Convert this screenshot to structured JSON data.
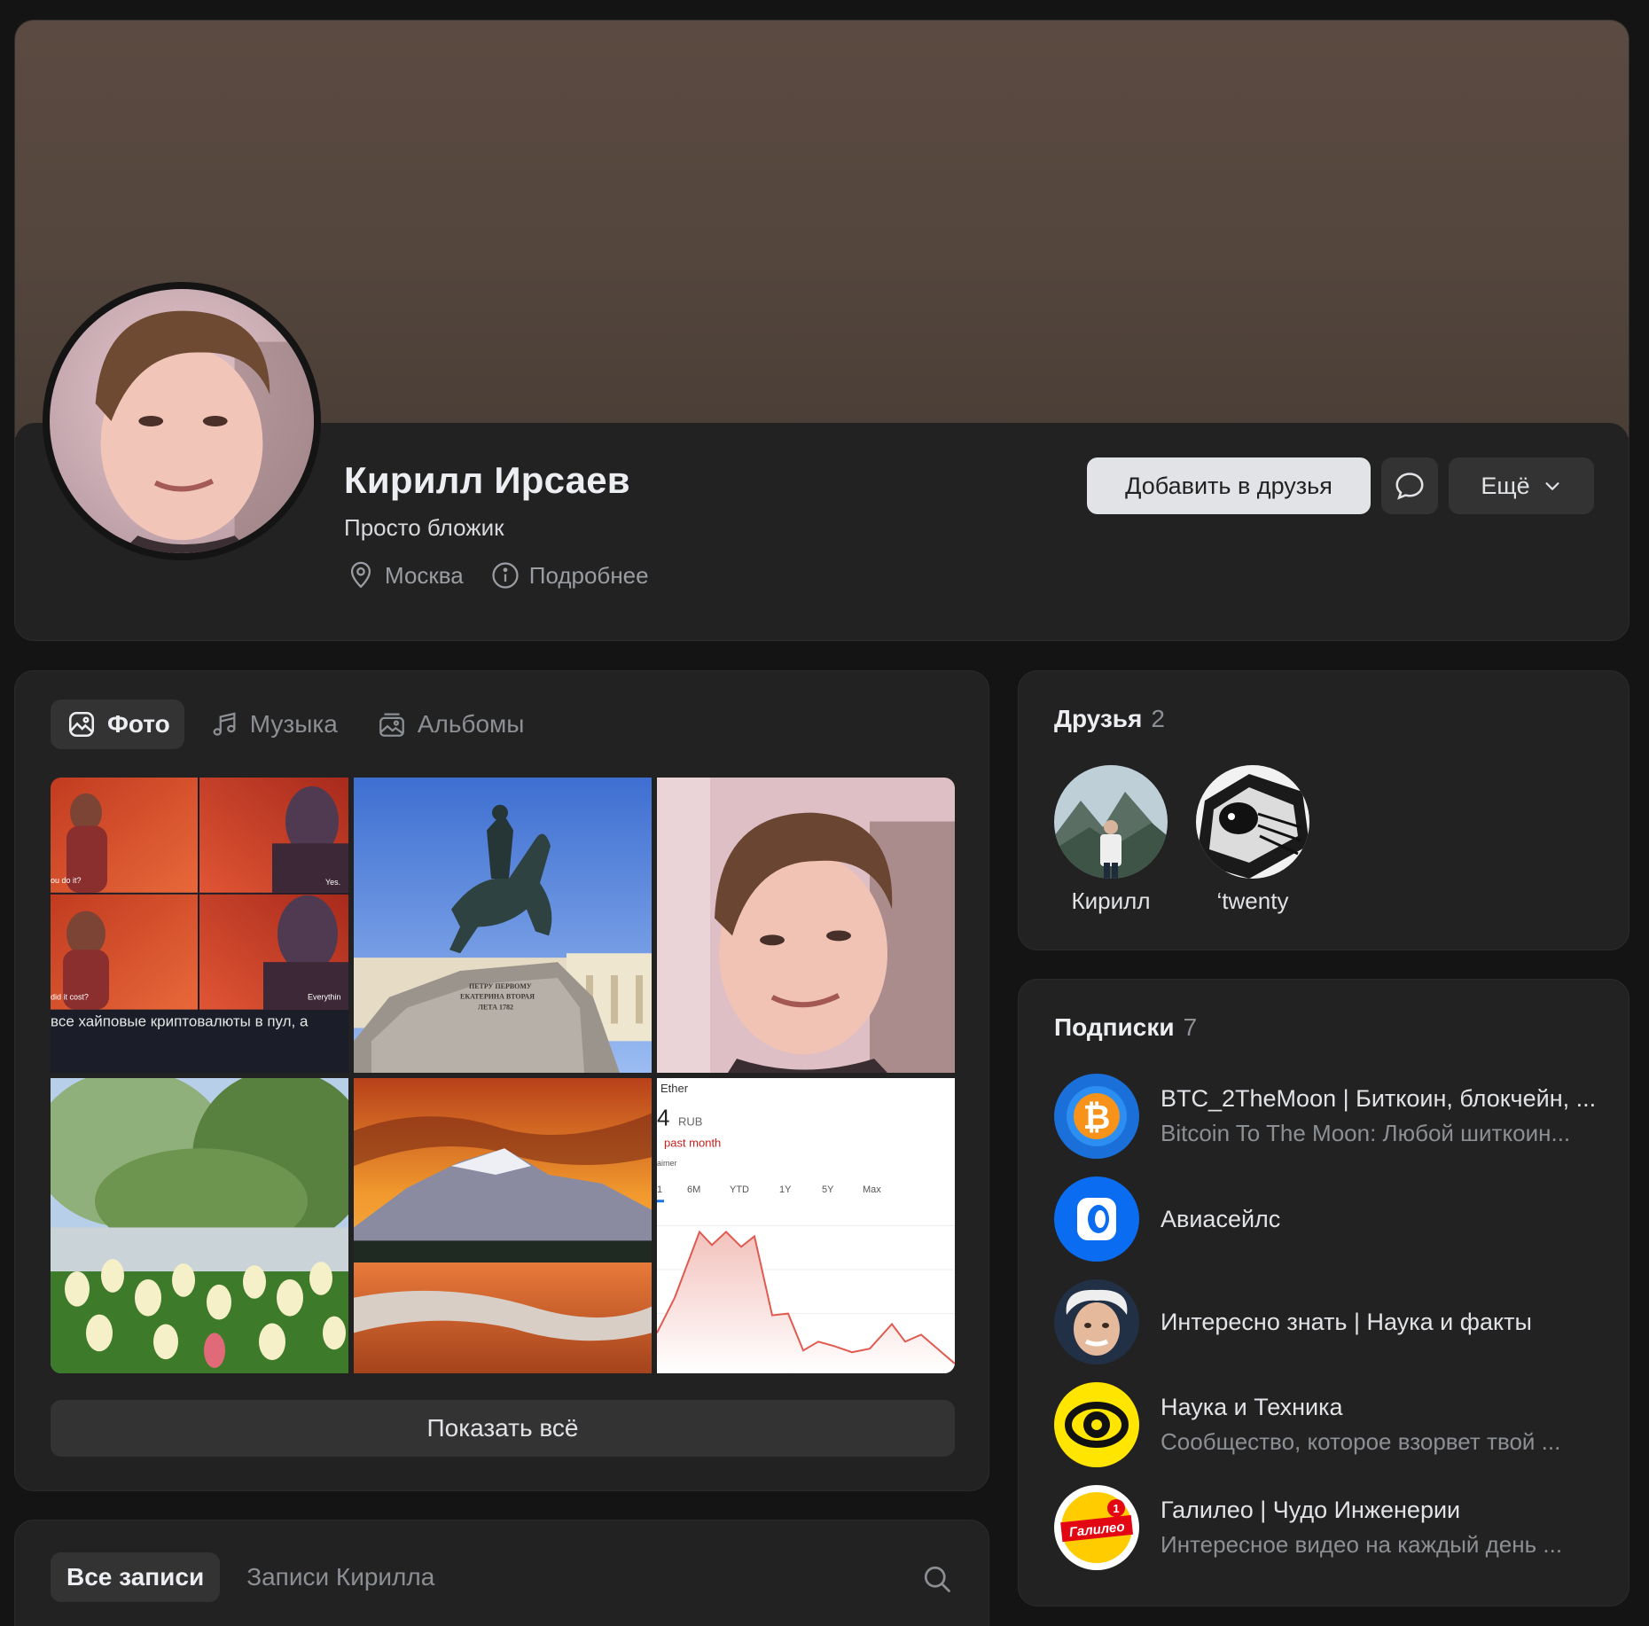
{
  "profile": {
    "name": "Кирилл Ирсаев",
    "status": "Просто бложик",
    "city": "Москва",
    "details_label": "Подробнее",
    "add_friend_label": "Добавить в друзья",
    "more_label": "Ещё"
  },
  "media": {
    "tabs": [
      {
        "label": "Фото",
        "icon": "image-icon",
        "active": true
      },
      {
        "label": "Музыка",
        "icon": "music-note-icon",
        "active": false
      },
      {
        "label": "Альбомы",
        "icon": "albums-icon",
        "active": false
      }
    ],
    "photos": [
      {
        "name": "photo-meme-thanos",
        "caption": "все хайповые криптовалюты в пул, а",
        "meme_texts": [
          "ou do it?",
          "Yes.",
          "did it cost?",
          "Everythin"
        ]
      },
      {
        "name": "photo-bronze-horseman",
        "inscription_1": "ПЕТРУ ПЕРВОМУ",
        "inscription_2": "ЕКАТЕРИНА ВТОРАЯ",
        "inscription_3": "ЛЕТА 1782"
      },
      {
        "name": "photo-portrait"
      },
      {
        "name": "photo-tulips"
      },
      {
        "name": "photo-mountain-sunset"
      },
      {
        "name": "photo-ether-chart",
        "title": "Ether",
        "value": "4",
        "unit": "RUB",
        "period": "past month",
        "disclaimer": "aimer",
        "ranges": [
          "1",
          "6M",
          "YTD",
          "1Y",
          "5Y",
          "Max"
        ]
      }
    ],
    "show_all_label": "Показать всё"
  },
  "posts": {
    "tabs": [
      {
        "label": "Все записи",
        "active": true
      },
      {
        "label": "Записи Кирилла",
        "active": false
      }
    ]
  },
  "friends": {
    "title": "Друзья",
    "count": "2",
    "items": [
      {
        "name": "Кирилл"
      },
      {
        "name": "‘twenty"
      }
    ]
  },
  "subscriptions": {
    "title": "Подписки",
    "count": "7",
    "items": [
      {
        "title": "BTC_2TheMoon | Биткоин, блокчейн, ...",
        "subtitle": "Bitcoin To The Moon: Любой шиткоин..."
      },
      {
        "title": "Авиасейлс",
        "subtitle": ""
      },
      {
        "title": "Интересно знать | Наука и факты",
        "subtitle": ""
      },
      {
        "title": "Наука и Техника",
        "subtitle": "Сообщество, которое взорвет твой ..."
      },
      {
        "title": "Галилео | Чудо Инженерии",
        "subtitle": "Интересное видео на каждый день ..."
      }
    ]
  },
  "logos": {
    "galileo_text": "Галилео",
    "galileo_badge": "1",
    "btc_symbol": "₿"
  },
  "colors": {
    "background": "#141414",
    "card": "#222222",
    "button_primary": "#e1e3e6",
    "button_secondary": "#333333",
    "text_secondary": "#8c8f93",
    "chart_line": "#e05a50"
  }
}
